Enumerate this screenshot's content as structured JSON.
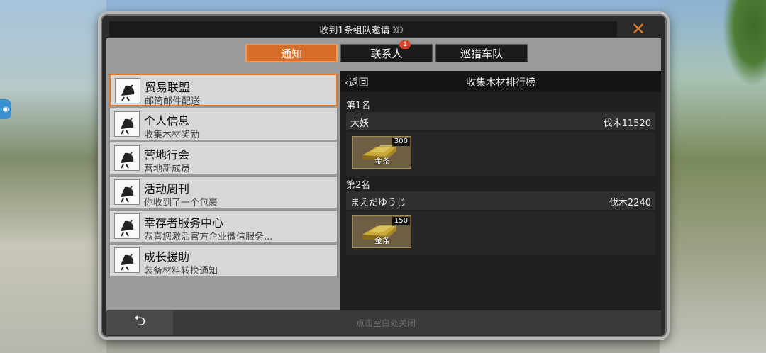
{
  "header": {
    "title": "收到1条组队邀请",
    "title_arrows": "》》》",
    "close_glyph": "✕"
  },
  "tabs": [
    {
      "label": "通知",
      "active": true
    },
    {
      "label": "联系人",
      "badge": "1"
    },
    {
      "label": "巡猎车队"
    }
  ],
  "list": {
    "items": [
      {
        "title": "贸易联盟",
        "subtitle": "邮筒邮件配送",
        "icon": "satellite-dish-icon"
      },
      {
        "title": "个人信息",
        "subtitle": "收集木材奖励",
        "icon": "satellite-dish-icon"
      },
      {
        "title": "营地行会",
        "subtitle": "营地新成员",
        "icon": "satellite-dish-icon"
      },
      {
        "title": "活动周刊",
        "subtitle": "你收到了一个包裹",
        "icon": "satellite-dish-icon"
      },
      {
        "title": "幸存者服务中心",
        "subtitle": "恭喜您激活官方企业微信服务...",
        "icon": "satellite-dish-icon"
      },
      {
        "title": "成长援助",
        "subtitle": "装备材料转换通知",
        "icon": "satellite-dish-icon"
      }
    ]
  },
  "detail": {
    "back_label": "返回",
    "back_icon": "chevron-left-icon",
    "title": "收集木材排行榜",
    "ranks": [
      {
        "label": "第1名",
        "name": "大妖",
        "score": "伐木11520",
        "reward": {
          "name": "金条",
          "qty": "300"
        }
      },
      {
        "label": "第2名",
        "name": "まえだゆうじ",
        "score": "伐木2240",
        "reward": {
          "name": "金条",
          "qty": "150"
        }
      }
    ]
  },
  "footer": {
    "back_icon": "return-arrow-icon",
    "hint": "点击空白处关闭"
  },
  "colors": {
    "accent_orange": "#d86d2a",
    "badge_red": "#d6452a"
  }
}
